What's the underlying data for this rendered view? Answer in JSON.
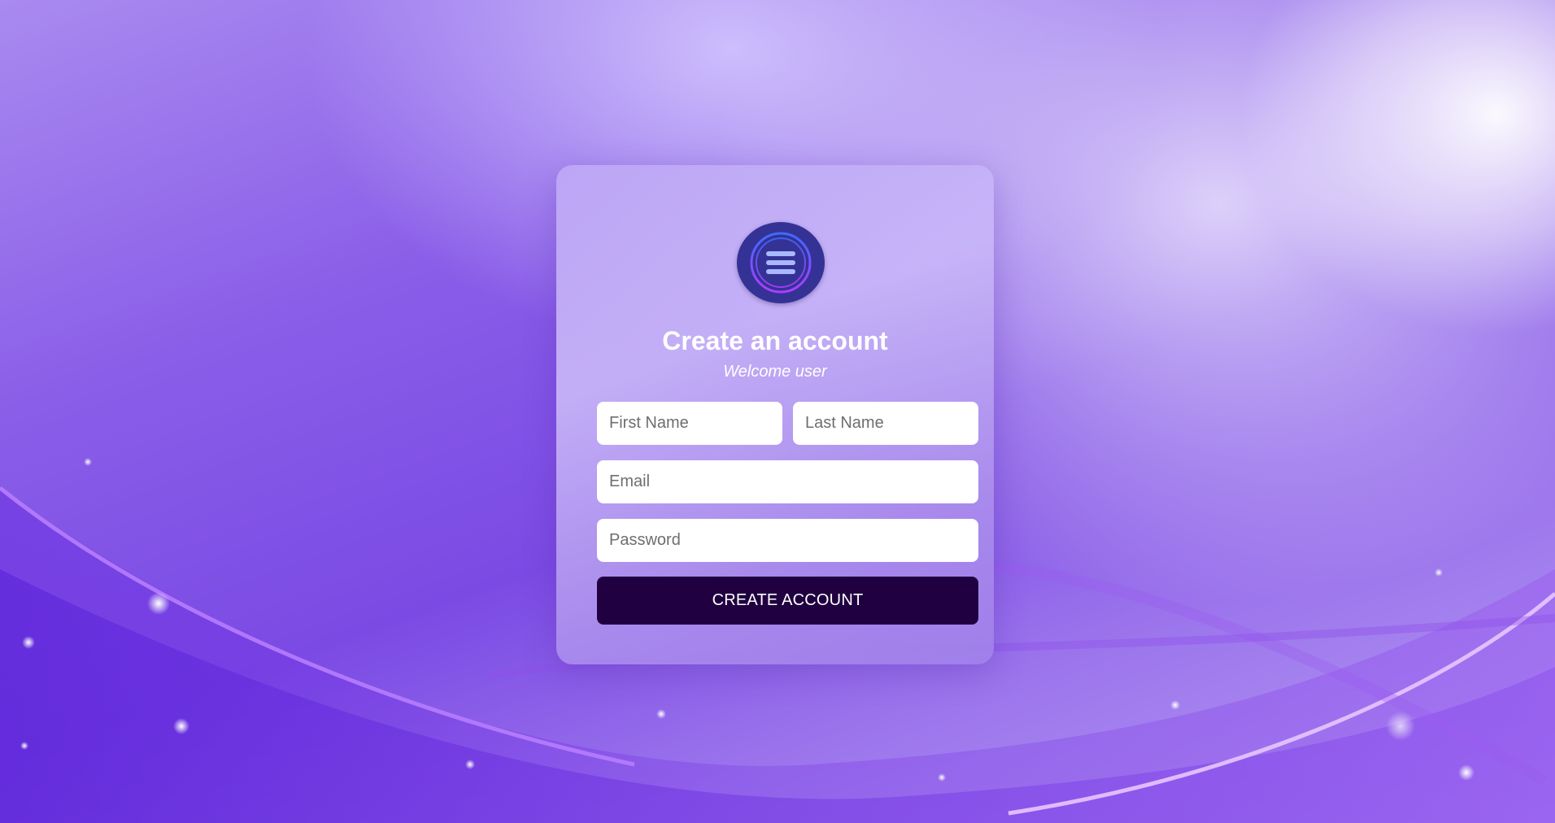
{
  "form": {
    "title": "Create an account",
    "subtitle": "Welcome user",
    "first_name_placeholder": "First Name",
    "last_name_placeholder": "Last Name",
    "email_placeholder": "Email",
    "password_placeholder": "Password",
    "submit_label": "CREATE ACCOUNT"
  },
  "logo": {
    "icon": "menu-icon",
    "background": "#343295",
    "ring_colors": [
      "#3d6bff",
      "#b03cff"
    ]
  },
  "colors": {
    "button_background": "#200040",
    "card_tint": "#b9a2f3",
    "background_accent": "#7b4ae4"
  }
}
